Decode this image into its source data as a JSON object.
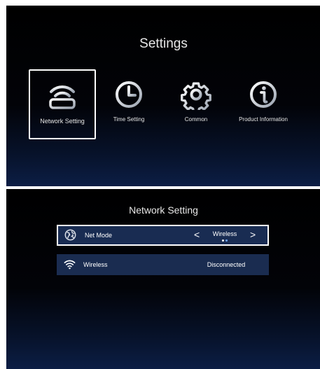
{
  "settings_screen": {
    "title": "Settings",
    "menu": [
      {
        "label": "Network Setting",
        "icon": "router-icon",
        "selected": true
      },
      {
        "label": "Time Setting",
        "icon": "clock-icon",
        "selected": false
      },
      {
        "label": "Common",
        "icon": "gear-icon",
        "selected": false
      },
      {
        "label": "Product Information",
        "icon": "info-icon",
        "selected": false
      }
    ]
  },
  "network_screen": {
    "title": "Network Setting",
    "rows": [
      {
        "icon": "globe-icon",
        "label": "Net Mode",
        "value": "Wireless",
        "left_arrow": "<",
        "right_arrow": ">",
        "options_total": 2,
        "option_selected": 2
      },
      {
        "icon": "wifi-icon",
        "label": "Wireless",
        "value": "Disconnected"
      }
    ]
  },
  "colors": {
    "text": "#ffffff",
    "row_background": "#1a2c50",
    "selection_border": "#ffffff",
    "dot_active": "#6da3ff",
    "dot_inactive": "#ffffff"
  }
}
